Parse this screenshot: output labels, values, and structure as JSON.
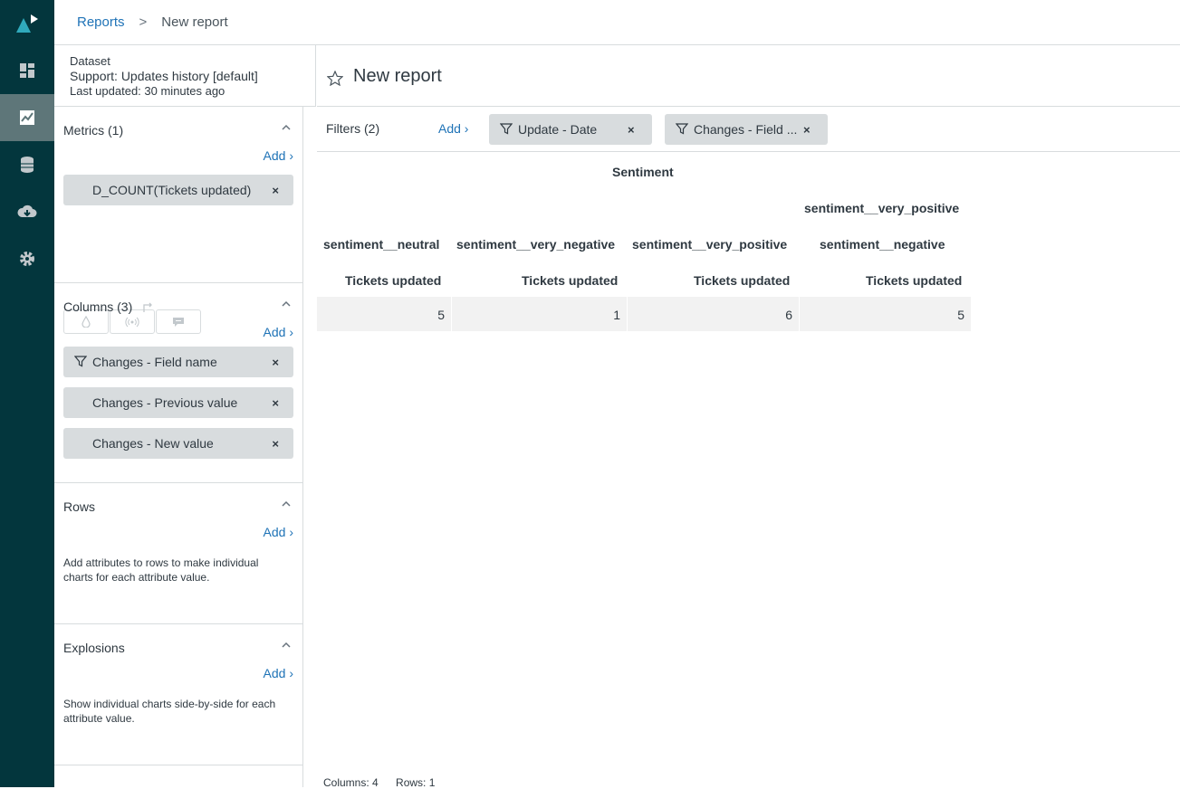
{
  "breadcrumb": {
    "parent": "Reports",
    "separator": ">",
    "current": "New report"
  },
  "dataset": {
    "label": "Dataset",
    "name": "Support: Updates history [default]",
    "updated": "Last updated: 30 minutes ago"
  },
  "report": {
    "title": "New report"
  },
  "metrics": {
    "title": "Metrics (1)",
    "add": "Add ›",
    "items": [
      "D_COUNT(Tickets updated)"
    ]
  },
  "columns": {
    "title": "Columns (3)",
    "add": "Add ›",
    "items": [
      "Changes - Field name",
      "Changes - Previous value",
      "Changes - New value"
    ]
  },
  "rows": {
    "title": "Rows",
    "add": "Add ›",
    "description": "Add attributes to rows to make individual charts for each attribute value."
  },
  "explosions": {
    "title": "Explosions",
    "add": "Add ›",
    "description": "Show individual charts side-by-side for each attribute value."
  },
  "filters": {
    "title": "Filters (2)",
    "add": "Add ›",
    "items": [
      "Update - Date",
      "Changes - Field ..."
    ]
  },
  "table": {
    "group_header": "Sentiment",
    "level2": [
      "",
      "",
      "",
      "sentiment__very_positive"
    ],
    "level3": [
      "sentiment__neutral",
      "sentiment__very_negative",
      "sentiment__very_positive",
      "sentiment__negative"
    ],
    "metric": [
      "Tickets updated",
      "Tickets updated",
      "Tickets updated",
      "Tickets updated"
    ],
    "values": [
      "5",
      "1",
      "6",
      "5"
    ]
  },
  "footer": {
    "columns": "Columns: 4",
    "rows": "Rows: 1"
  },
  "colors": {
    "nav": "#03363d",
    "nav_active": "#5e7679",
    "link": "#1f73b7",
    "pill": "#d8dcde"
  }
}
